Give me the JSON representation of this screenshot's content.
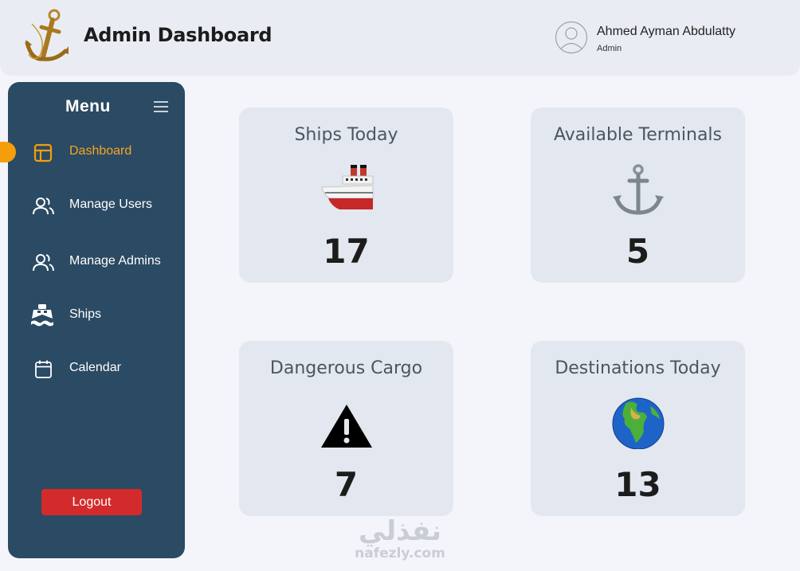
{
  "header": {
    "title": "Admin Dashboard",
    "logo_icon": "anchor-logo-icon",
    "user": {
      "name": "Ahmed Ayman Abdulatty",
      "role": "Admin",
      "avatar_icon": "user-avatar-icon"
    }
  },
  "sidebar": {
    "title": "Menu",
    "toggle_icon": "hamburger-icon",
    "items": [
      {
        "label": "Dashboard",
        "icon": "layout-icon",
        "active": true
      },
      {
        "label": "Manage Users",
        "icon": "users-icon",
        "active": false
      },
      {
        "label": "Manage Admins",
        "icon": "users-icon",
        "active": false
      },
      {
        "label": "Ships",
        "icon": "ship-icon",
        "active": false
      },
      {
        "label": "Calendar",
        "icon": "calendar-icon",
        "active": false
      }
    ],
    "logout_label": "Logout"
  },
  "cards": [
    {
      "title": "Ships Today",
      "value": "17",
      "icon": "ship-emoji-icon"
    },
    {
      "title": "Available Terminals",
      "value": "5",
      "icon": "anchor-emoji-icon"
    },
    {
      "title": "Dangerous Cargo",
      "value": "7",
      "icon": "warning-icon"
    },
    {
      "title": "Destinations Today",
      "value": "13",
      "icon": "globe-icon"
    }
  ],
  "watermark": {
    "arabic": "نفذلي",
    "latin": "nafezly.com"
  },
  "colors": {
    "sidebar": "#2b4a63",
    "accent": "#f59e0b",
    "active_text": "#f5a623",
    "logout": "#d32b2b",
    "card_bg": "#e3e8f0",
    "page_bg": "#f3f5fa"
  }
}
